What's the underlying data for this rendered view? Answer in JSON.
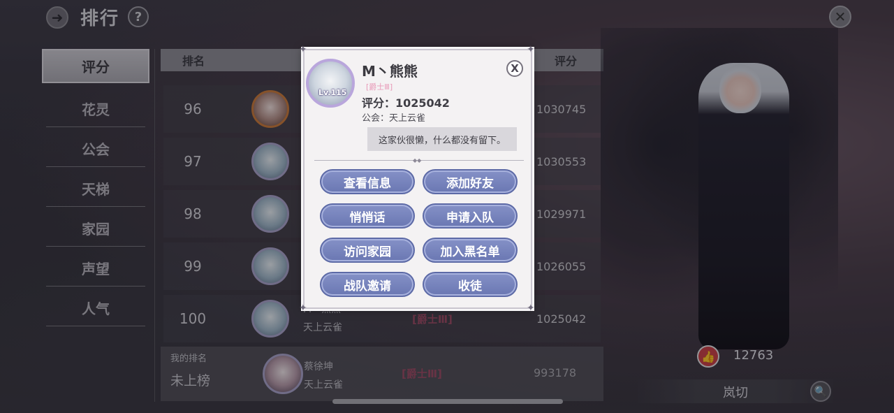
{
  "header": {
    "title": "排行",
    "back_icon": "back-arrow-icon",
    "help_icon": "?",
    "close_icon": "close-icon"
  },
  "categories": [
    {
      "label": "评分",
      "active": true
    },
    {
      "label": "花灵",
      "active": false
    },
    {
      "label": "公会",
      "active": false
    },
    {
      "label": "天梯",
      "active": false
    },
    {
      "label": "家园",
      "active": false
    },
    {
      "label": "声望",
      "active": false
    },
    {
      "label": "人气",
      "active": false
    }
  ],
  "table": {
    "col_rank": "排名",
    "col_score": "评分",
    "rows": [
      {
        "rank": "96",
        "score": "1030745"
      },
      {
        "rank": "97",
        "score": "1030553"
      },
      {
        "rank": "98",
        "score": "1029971"
      },
      {
        "rank": "99",
        "score": "1026055"
      },
      {
        "rank": "100",
        "name": "M丶熊熊",
        "guild": "天上云雀",
        "title": "[爵士Ⅲ]",
        "score": "1025042"
      }
    ]
  },
  "my_rank": {
    "label": "我的排名",
    "value": "未上榜",
    "name": "蔡徐坤",
    "guild": "天上云雀",
    "title": "[爵士Ⅲ]",
    "score": "993178"
  },
  "character": {
    "likes": "12763",
    "name": "岚切"
  },
  "popup": {
    "level": "Lv.115",
    "name": "M丶熊熊",
    "title": "[爵士Ⅲ]",
    "score": "评分：1025042",
    "guild": "公会：天上云雀",
    "signature": "这家伙很懒，什么都没有留下。",
    "close": "X",
    "buttons": {
      "view_info": "查看信息",
      "add_friend": "添加好友",
      "whisper": "悄悄话",
      "join_team": "申请入队",
      "visit_home": "访问家园",
      "blacklist": "加入黑名单",
      "team_invite": "战队邀请",
      "apprentice": "收徒"
    }
  },
  "colors": {
    "button": "#7480bb",
    "title_badge": "#9b4a63",
    "popup_bg": "#f4f2f3"
  }
}
